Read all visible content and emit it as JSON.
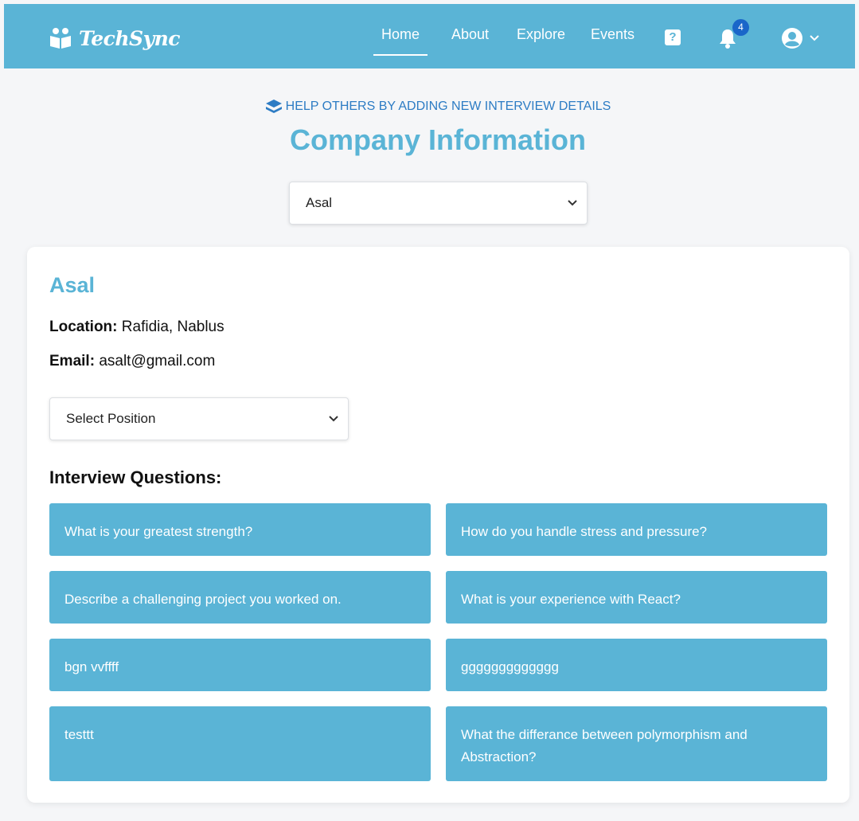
{
  "nav": {
    "brand": "TechSync",
    "links": [
      {
        "label": "Home",
        "active": true
      },
      {
        "label": "About",
        "active": false
      },
      {
        "label": "Explore",
        "active": false
      },
      {
        "label": "Events",
        "active": false
      }
    ],
    "help_icon": "question-square-icon",
    "notification_count": "4",
    "brand_color": "#5ab4d6",
    "badge_color": "#1a66c9"
  },
  "header": {
    "help_text": "HELP OTHERS BY ADDING NEW INTERVIEW DETAILS",
    "title": "Company Information",
    "company_select_value": "Asal"
  },
  "company": {
    "name": "Asal",
    "location_label": "Location:",
    "location_value": "Rafidia, Nablus",
    "email_label": "Email:",
    "email_value": "asalt@gmail.com",
    "position_select_value": "Select Position",
    "questions_heading": "Interview Questions:",
    "questions": [
      "What is your greatest strength?",
      "How do you handle stress and pressure?",
      "Describe a challenging project you worked on.",
      "What is your experience with React?",
      "bgn vvffff",
      "ggggggggggggg",
      "testtt",
      "What the differance between polymorphism and Abstraction?"
    ]
  }
}
